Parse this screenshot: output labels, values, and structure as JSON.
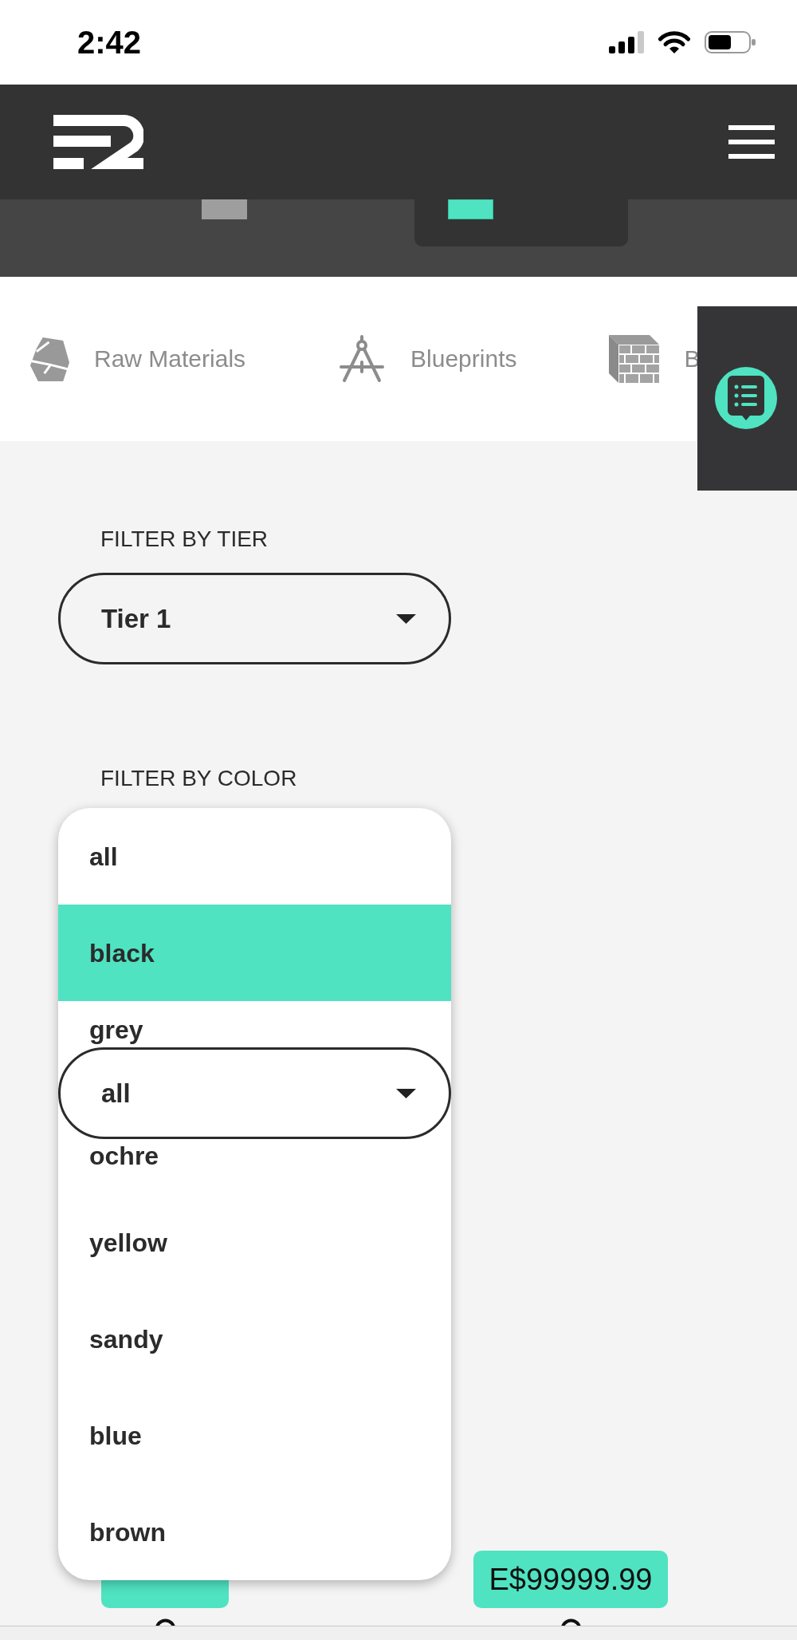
{
  "status_bar": {
    "time": "2:42"
  },
  "storage_tabs": [
    {
      "selected": false
    },
    {
      "selected": true
    }
  ],
  "categories": [
    {
      "label": "Raw Materials",
      "kind": "rock"
    },
    {
      "label": "Blueprints",
      "kind": "compass"
    },
    {
      "label": "B",
      "kind": "bricks"
    }
  ],
  "filters": [
    {
      "label": "FILTER BY TIER",
      "value": "Tier 1",
      "expanded": false
    },
    {
      "label": "FILTER BY COLOR",
      "value": "all",
      "expanded": true,
      "options": [
        {
          "label": "all",
          "highlighted": false
        },
        {
          "label": "black",
          "highlighted": true
        },
        {
          "label": "grey",
          "highlighted": false
        },
        {
          "label": "ochre",
          "highlighted": false
        },
        {
          "label": "yellow",
          "highlighted": false
        },
        {
          "label": "sandy",
          "highlighted": false
        },
        {
          "label": "blue",
          "highlighted": false
        },
        {
          "label": "brown",
          "highlighted": false
        }
      ]
    }
  ],
  "products": [
    {
      "kind": "covered"
    },
    {
      "kind": "priced",
      "price": "E$99999.99"
    }
  ]
}
